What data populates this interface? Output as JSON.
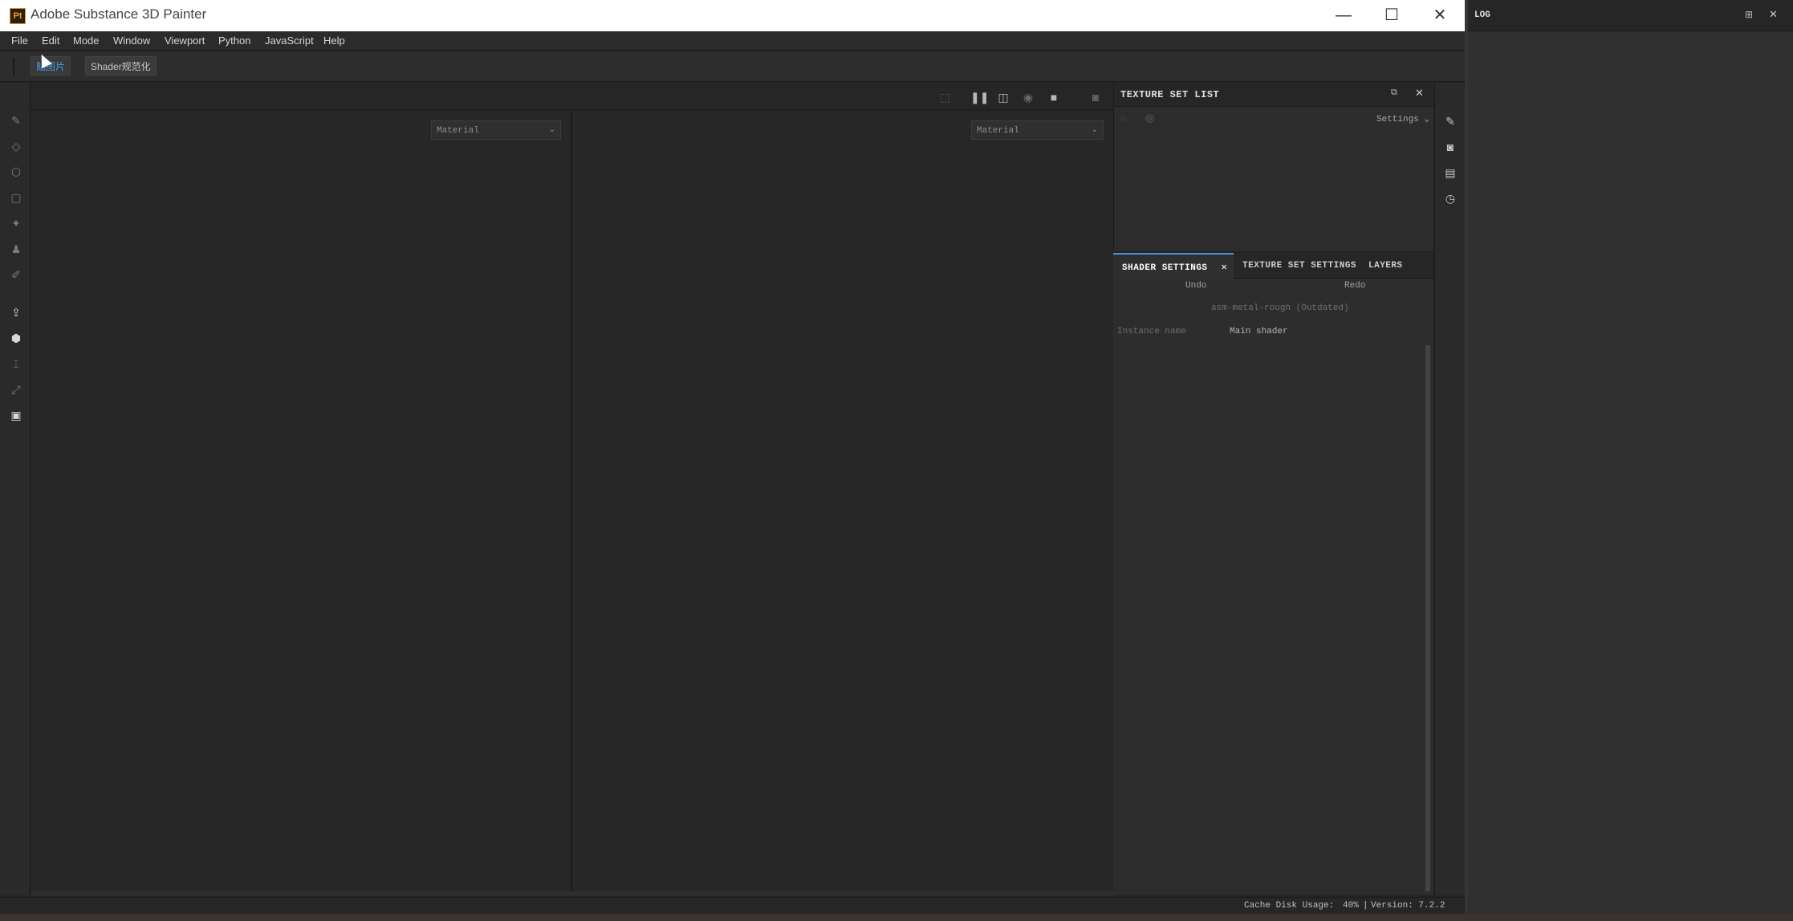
{
  "window": {
    "title": "Adobe Substance 3D Painter",
    "logo": "Pt",
    "minimize_icon": "—",
    "maximize_icon": "☐",
    "close_icon": "✕"
  },
  "menu": [
    "File",
    "Edit",
    "Mode",
    "Window",
    "Viewport",
    "Python",
    "JavaScript",
    "Help"
  ],
  "shelf": {
    "button1": "贴图片",
    "button2": "Shader规范化"
  },
  "viewport": {
    "left_dropdown": "Material",
    "right_dropdown": "Material"
  },
  "texture_set_list": {
    "title": "TEXTURE SET LIST",
    "settings_label": "Settings"
  },
  "tabs": {
    "shader_settings": "SHADER SETTINGS",
    "texture_set_settings": "TEXTURE SET SETTINGS",
    "layers": "LAYERS"
  },
  "shader": {
    "undo": "Undo",
    "redo": "Redo",
    "shader_name": "asm-metal-rough (Outdated)",
    "instance_label": "Instance name",
    "instance_value": "Main shader"
  },
  "status": {
    "cache_label": "Cache Disk Usage:",
    "cache_value": "40%",
    "separator": "|",
    "version": "Version: 7.2.2"
  },
  "log": {
    "title": "LOG"
  },
  "colors": {
    "active_tab_accent": "#4a90e2",
    "shelf_active_text": "#4a9ff5"
  }
}
